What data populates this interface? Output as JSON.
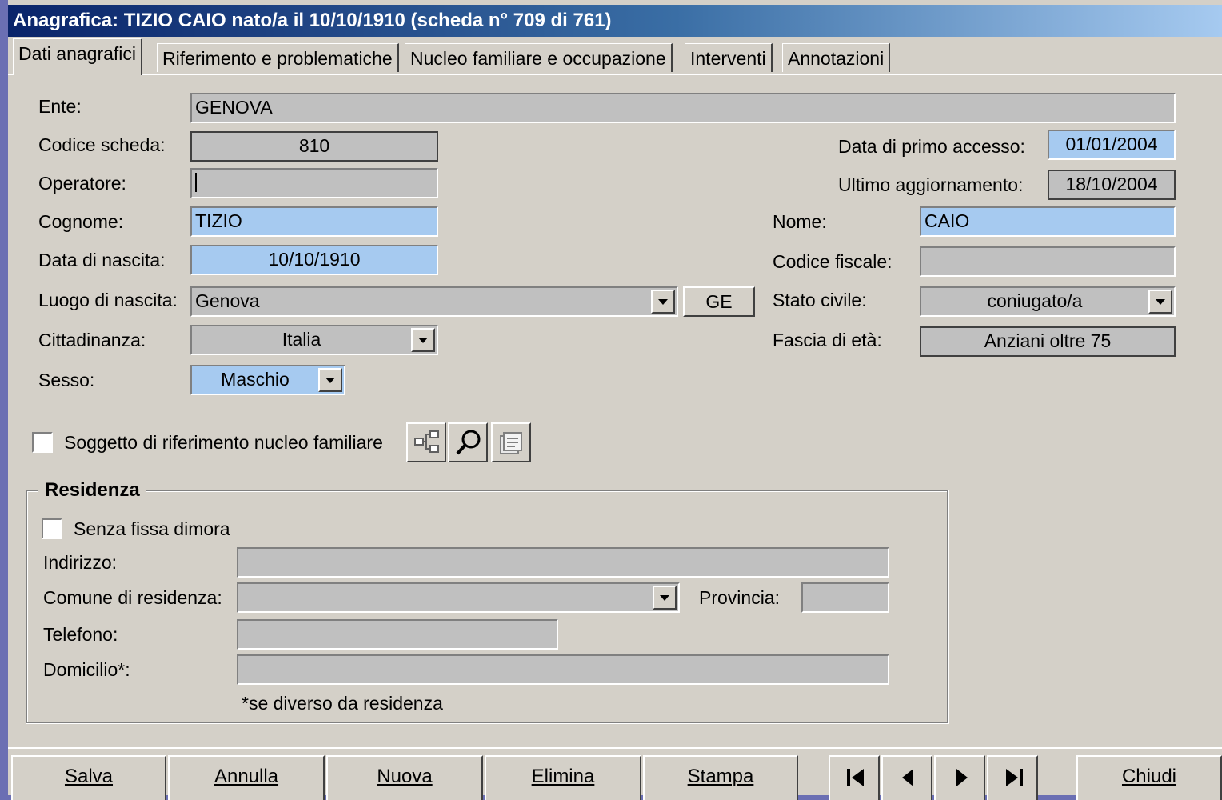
{
  "window": {
    "title": "Anagrafica: TIZIO CAIO nato/a il 10/10/1910 (scheda n° 709 di 761)"
  },
  "tabs": [
    {
      "label": "Dati anagrafici"
    },
    {
      "label": "Riferimento e problematiche"
    },
    {
      "label": "Nucleo familiare e occupazione"
    },
    {
      "label": "Interventi"
    },
    {
      "label": "Annotazioni"
    }
  ],
  "form": {
    "ente": {
      "label": "Ente:",
      "value": "GENOVA"
    },
    "codice_scheda": {
      "label": "Codice scheda:",
      "value": "810"
    },
    "operatore": {
      "label": "Operatore:",
      "value": ""
    },
    "cognome": {
      "label": "Cognome:",
      "value": "TIZIO"
    },
    "data_nascita": {
      "label": "Data di nascita:",
      "value": "10/10/1910"
    },
    "luogo_nascita": {
      "label": "Luogo di nascita:",
      "value": "Genova",
      "provincia": "GE"
    },
    "cittadinanza": {
      "label": "Cittadinanza:",
      "value": "Italia"
    },
    "sesso": {
      "label": "Sesso:",
      "value": "Maschio"
    },
    "data_primo_accesso": {
      "label": "Data  di primo accesso:",
      "value": "01/01/2004"
    },
    "ultimo_aggiornamento": {
      "label": "Ultimo aggiornamento:",
      "value": "18/10/2004"
    },
    "nome": {
      "label": "Nome:",
      "value": "CAIO"
    },
    "codice_fiscale": {
      "label": "Codice fiscale:",
      "value": ""
    },
    "stato_civile": {
      "label": "Stato civile:",
      "value": "coniugato/a"
    },
    "fascia_eta": {
      "label": "Fascia di età:",
      "value": "Anziani oltre 75"
    },
    "soggetto_riferimento": {
      "label": "Soggetto di riferimento nucleo familiare",
      "checked": false
    }
  },
  "residenza": {
    "title": "Residenza",
    "senza_fissa_dimora": {
      "label": "Senza fissa dimora",
      "checked": false
    },
    "indirizzo": {
      "label": "Indirizzo:",
      "value": ""
    },
    "comune": {
      "label": "Comune di residenza:",
      "value": ""
    },
    "provincia": {
      "label": "Provincia:",
      "value": ""
    },
    "telefono": {
      "label": "Telefono:",
      "value": ""
    },
    "domicilio": {
      "label": "Domicilio*:",
      "value": ""
    },
    "note": "*se diverso da residenza"
  },
  "icons": {
    "tree": "hierarchy-icon",
    "search": "magnifier-icon",
    "properties": "properties-icon"
  },
  "toolbar": {
    "salva": "Salva",
    "annulla": "Annulla",
    "nuova": "Nuova",
    "elimina": "Elimina",
    "stampa": "Stampa",
    "chiudi": "Chiudi"
  },
  "colors": {
    "highlight_field": "#a6caf0",
    "readonly_field": "#c0c0c0",
    "face": "#d4d0c8",
    "title_start": "#0a246a"
  }
}
